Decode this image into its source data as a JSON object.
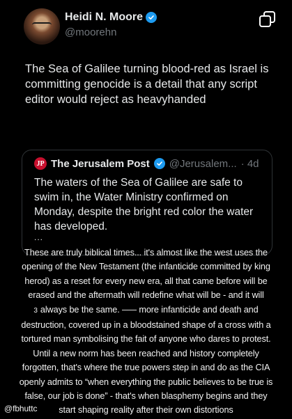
{
  "tweet": {
    "display_name": "Heidi N. Moore",
    "handle": "@moorehn",
    "text": "The Sea of Galilee turning blood-red as Israel is committing genocide is a detail that any script editor would reject as heavyhanded"
  },
  "quote": {
    "name": "The Jerusalem Post",
    "handle": "@Jerusalem...",
    "time": "· 4d",
    "logo_letters": "JP",
    "body": "The waters of the Sea of Galilee are safe to swim in, the Water Ministry confirmed on Monday, despite the bright red color the water has developed.",
    "more": "..."
  },
  "caption": {
    "lines": [
      "These are truly biblical times... it's almost like the west uses the",
      "opening of the New Testament (the infanticide committed by king",
      "herod) as a reset for every new era, all that came before will be",
      "erased and the aftermath will redefine what will be - and it will",
      "always be the same. ––– more infanticide and death and",
      "destruction, covered up in a bloodstained shape of a cross with a",
      "tortured man symbolising the fait of anyone who dares to protest.",
      "Until a new norm has been reached and history completely",
      "forgotten, that's where the true powers step in and do as the CIA",
      "openly admits to “when everything the public believes to be true is",
      "false, our job is done” - that's when blasphemy begins and they",
      "start shaping reality after their own distortions"
    ],
    "number": "3",
    "username": "@fbhuttc"
  },
  "icons": {
    "verified": "verified-badge-icon",
    "copy": "copy-icon"
  },
  "colors": {
    "background": "#000000",
    "text": "#e7e9ea",
    "muted": "#71767b",
    "verified": "#1d9bf0",
    "jpost": "#c8102e"
  }
}
